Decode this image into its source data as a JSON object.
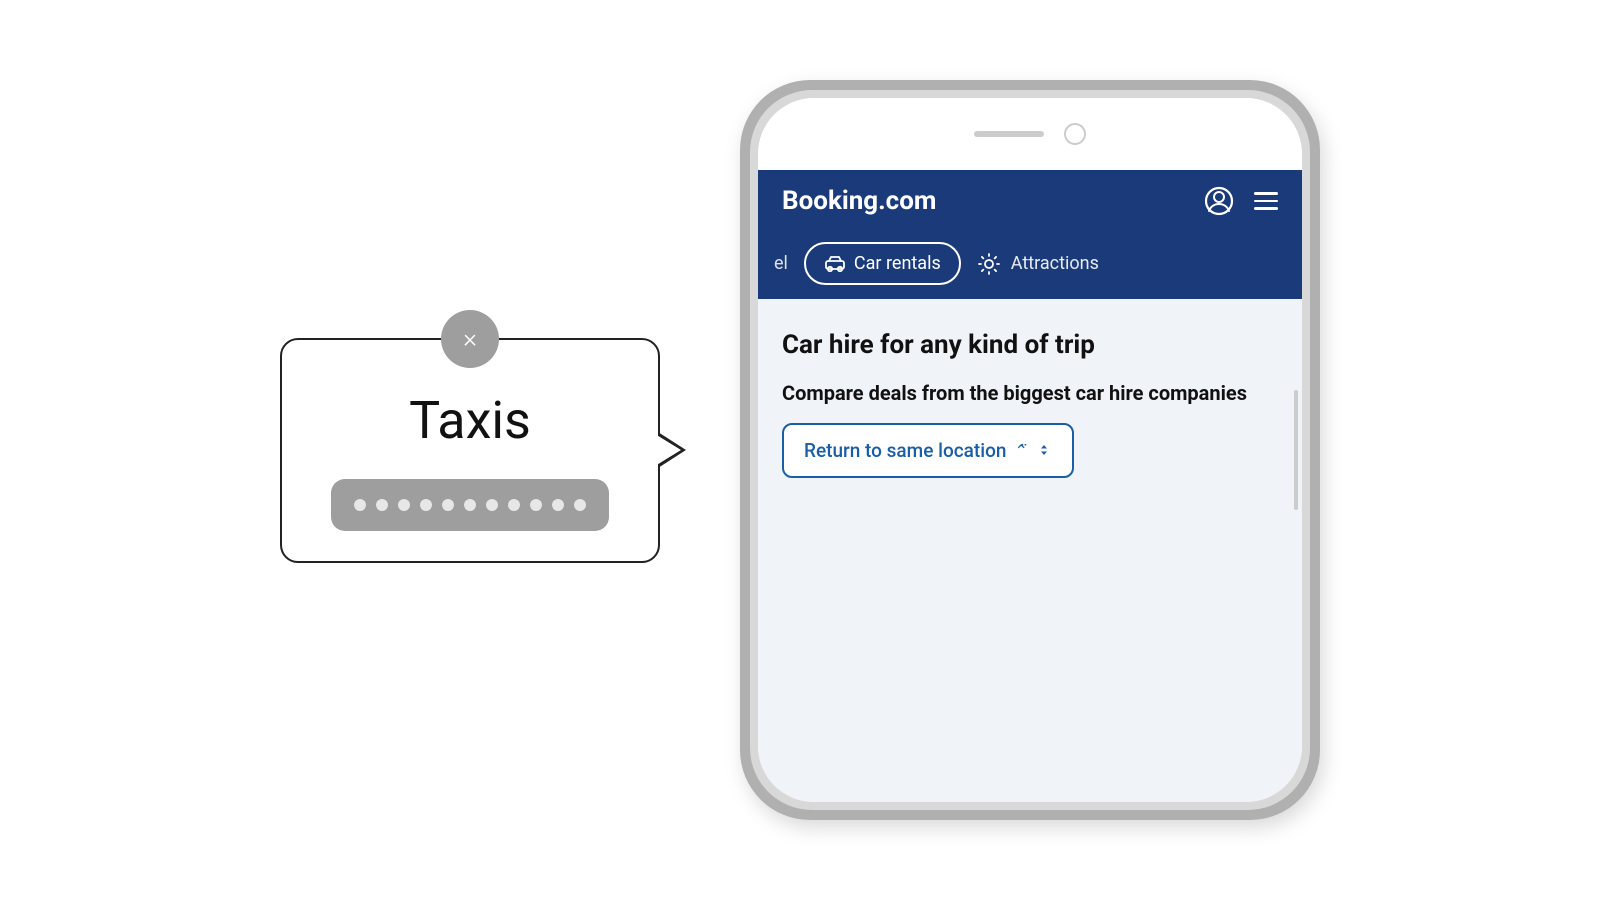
{
  "left_panel": {
    "close_icon": "×",
    "taxis_label": "Taxis",
    "dots_count": 11
  },
  "phone": {
    "header": {
      "logo": "Booking.com",
      "user_icon": "👤",
      "menu_icon": "☰"
    },
    "nav": {
      "partial_tab": "el",
      "car_rentals_label": "Car rentals",
      "attractions_label": "Attractions"
    },
    "content": {
      "title": "Car hire for any kind of trip",
      "subtitle": "Compare deals from the biggest car hire companies",
      "return_button": "Return to same location"
    }
  }
}
